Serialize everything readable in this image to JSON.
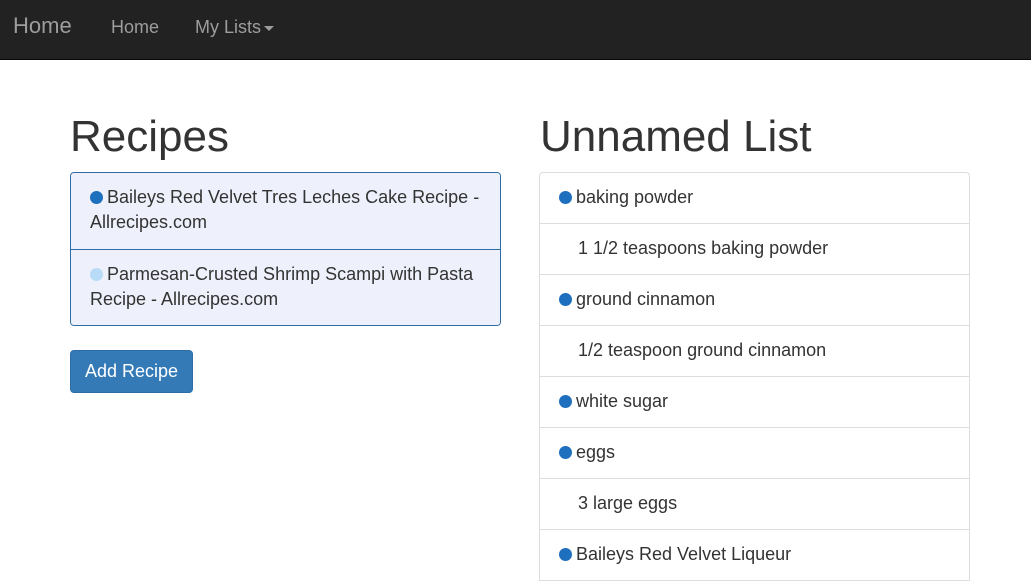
{
  "colors": {
    "dot_active": "#1f6fbf",
    "dot_light": "#b8dcf8",
    "primary": "#337ab7"
  },
  "navbar": {
    "brand": "Home",
    "home_link": "Home",
    "lists_link": "My Lists"
  },
  "recipes": {
    "title": "Recipes",
    "items": [
      {
        "label": "Baileys Red Velvet Tres Leches Cake Recipe - Allrecipes.com",
        "dot_color": "#1f6fbf"
      },
      {
        "label": "Parmesan-Crusted Shrimp Scampi with Pasta Recipe - Allrecipes.com",
        "dot_color": "#b8dcf8"
      }
    ],
    "add_button": "Add Recipe"
  },
  "list": {
    "title": "Unnamed List",
    "rows": [
      {
        "type": "ingredient",
        "text": "baking powder"
      },
      {
        "type": "detail",
        "text": "1 1/2 teaspoons baking powder"
      },
      {
        "type": "ingredient",
        "text": "ground cinnamon"
      },
      {
        "type": "detail",
        "text": "1/2 teaspoon ground cinnamon"
      },
      {
        "type": "ingredient",
        "text": "white sugar"
      },
      {
        "type": "ingredient",
        "text": "eggs"
      },
      {
        "type": "detail",
        "text": "3 large eggs"
      },
      {
        "type": "ingredient",
        "text": "Baileys Red Velvet Liqueur"
      }
    ]
  }
}
